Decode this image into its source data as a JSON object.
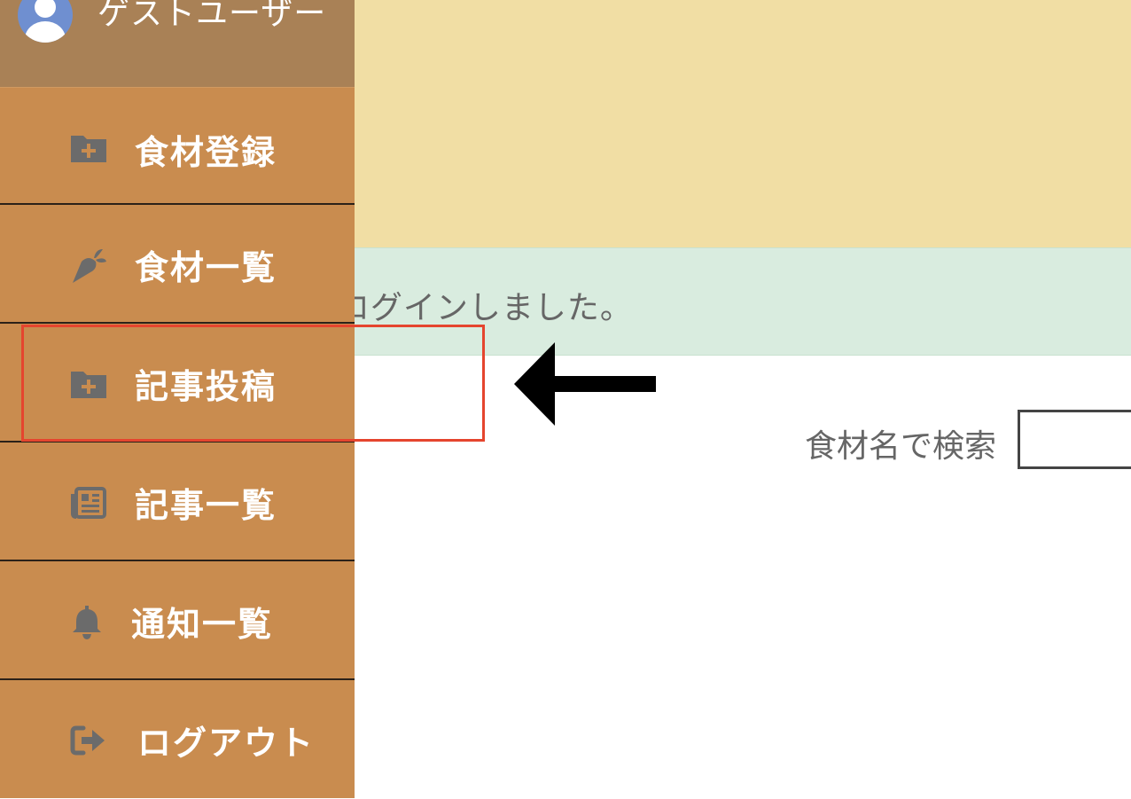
{
  "user": {
    "name": "ゲストユーザー",
    "avatar_icon": "user-avatar-icon"
  },
  "sidebar": {
    "items": [
      {
        "label": "食材登録",
        "icon": "folder-plus-icon"
      },
      {
        "label": "食材一覧",
        "icon": "carrot-icon"
      },
      {
        "label": "記事投稿",
        "icon": "folder-plus-icon"
      },
      {
        "label": "記事一覧",
        "icon": "newspaper-icon"
      },
      {
        "label": "通知一覧",
        "icon": "bell-icon"
      },
      {
        "label": "ログアウト",
        "icon": "sign-out-icon"
      }
    ]
  },
  "flash": {
    "message": "ゲストとしてログインしました。"
  },
  "search": {
    "label": "食材名で検索",
    "value": ""
  },
  "annotation": {
    "highlight_color": "#e5452e",
    "arrow_color": "#000000"
  },
  "colors": {
    "sidebar": "#c98c4f",
    "user_block": "#a98156",
    "header": "#f1dea4",
    "flash": "#d9ecdf",
    "icon": "#6b6b6b"
  }
}
